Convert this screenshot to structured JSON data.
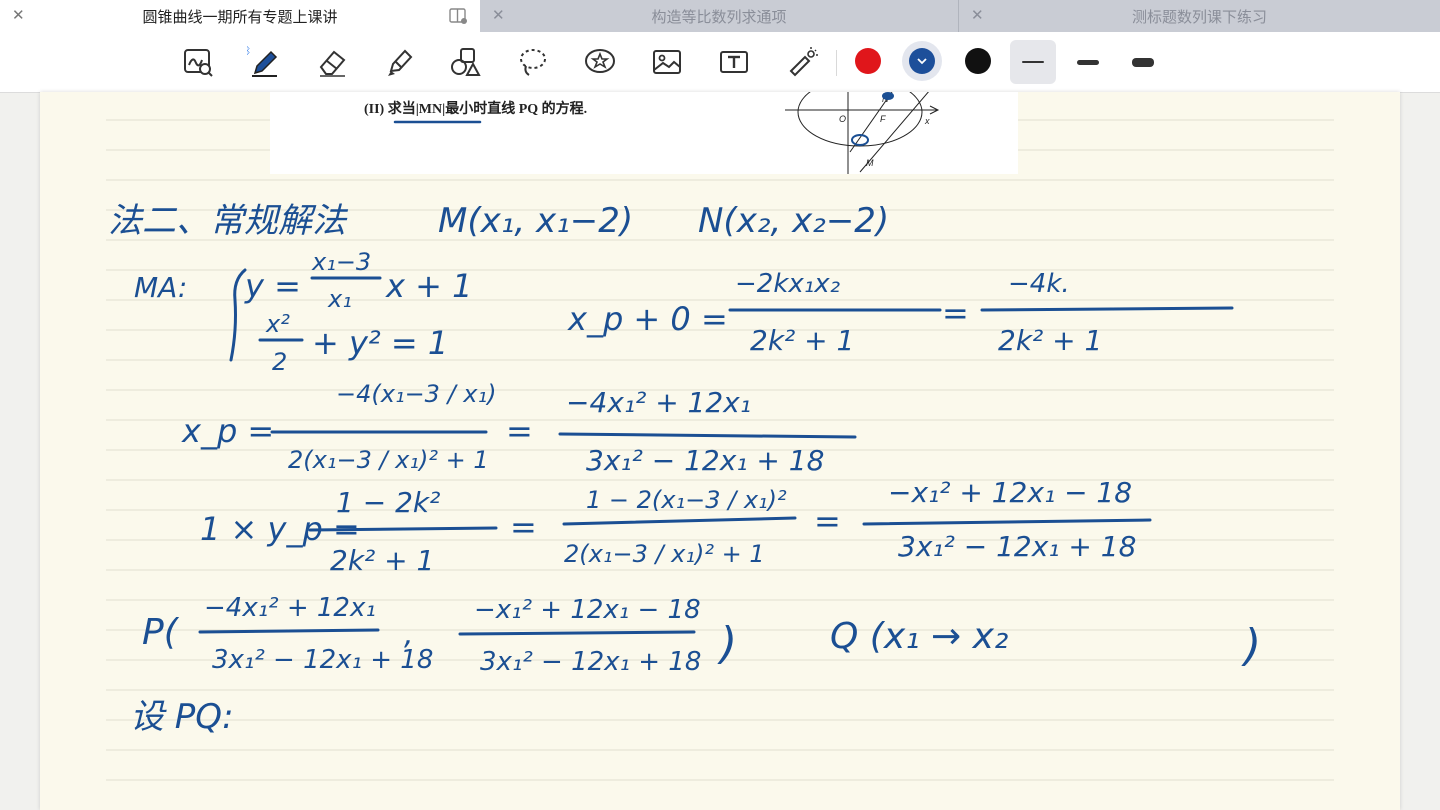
{
  "tabs": [
    {
      "title": "圆锥曲线一期所有专题上课讲",
      "active": true
    },
    {
      "title": "构造等比数列求通项",
      "active": false
    },
    {
      "title": "测标题数列课下练习",
      "active": false
    }
  ],
  "toolbar": {
    "tools": [
      "zoom-handwriting-icon",
      "pen-icon",
      "eraser-icon",
      "highlighter-icon",
      "shapes-icon",
      "lasso-icon",
      "sticker-icon",
      "image-icon",
      "text-box-icon",
      "laser-pointer-icon"
    ],
    "colors": [
      "#e0161b",
      "#1d4f9a",
      "#111111"
    ],
    "selected_color": "#1d4f9a"
  },
  "problem": {
    "text": "(II) 求当|MN|最小时直线 PQ 的方程."
  },
  "notes": {
    "line1_a": "法二、常规解法",
    "line1_b": "M(x₁, x₁−2)",
    "line1_c": "N(x₂, x₂−2)",
    "ma_label": "MA:",
    "sys1": "y = ",
    "sys1_num": "x₁−3",
    "sys1_den": "x₁",
    "sys1_tail": "x + 1",
    "sys2_num": "x²",
    "sys2_den": "2",
    "sys2_tail": "+ y² = 1",
    "xp0_lhs": "x_p + 0 =",
    "xp0_num": "−2kx₁x₂",
    "xp0_den": "2k² + 1",
    "xp0_eq": "=",
    "xp0_num2": "−4k.",
    "xp0_den2": "2k² + 1",
    "xp_lhs": "x_p =",
    "xp_num": "−4(x₁−3 / x₁)",
    "xp_den": "2(x₁−3 / x₁)² + 1",
    "xp_eq": "=",
    "xp_num2": "−4x₁² + 12x₁",
    "xp_den2": "3x₁² − 12x₁ + 18",
    "yp_lhs": "1 × y_p =",
    "yp_num": "1 − 2k²",
    "yp_den": "2k² + 1",
    "yp_eq": "=",
    "yp_num2": "1 − 2(x₁−3 / x₁)²",
    "yp_den2": "2(x₁−3 / x₁)² + 1",
    "yp_eq2": "=",
    "yp_num3": "−x₁² + 12x₁ − 18",
    "yp_den3": "3x₁² − 12x₁ + 18",
    "p_label": "P(",
    "p_num1": "−4x₁² + 12x₁",
    "p_den1": "3x₁² − 12x₁ + 18",
    "p_comma": ",",
    "p_num2": "−x₁² + 12x₁ − 18",
    "p_den2": "3x₁² − 12x₁ + 18",
    "p_close": ")",
    "q_label": "Q (x₁ → x₂",
    "q_close": ")",
    "last": "设 PQ:"
  }
}
